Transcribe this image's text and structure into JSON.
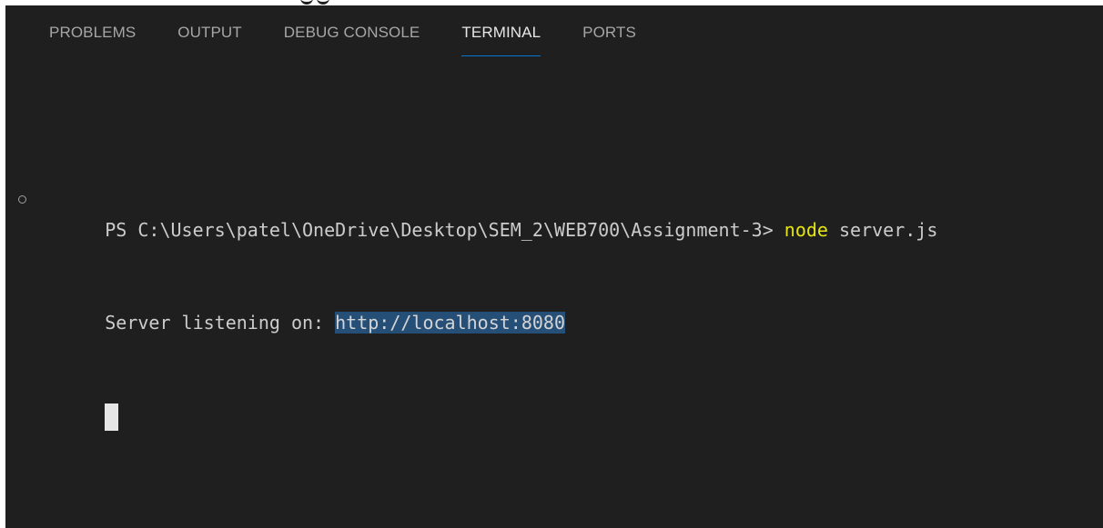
{
  "tabs": [
    {
      "label": "PROBLEMS",
      "active": false
    },
    {
      "label": "OUTPUT",
      "active": false
    },
    {
      "label": "DEBUG CONSOLE",
      "active": false
    },
    {
      "label": "TERMINAL",
      "active": true
    },
    {
      "label": "PORTS",
      "active": false
    }
  ],
  "terminal": {
    "prompt": "PS C:\\Users\\patel\\OneDrive\\Desktop\\SEM_2\\WEB700\\Assignment-3> ",
    "command": "node",
    "args": " server.js",
    "output_prefix": "Server listening on: ",
    "output_url": "http://localhost:8080"
  },
  "colors": {
    "background": "#1f1f1f",
    "command": "#e5e510",
    "selection": "#264f78",
    "active_tab_underline": "#0078d4"
  }
}
